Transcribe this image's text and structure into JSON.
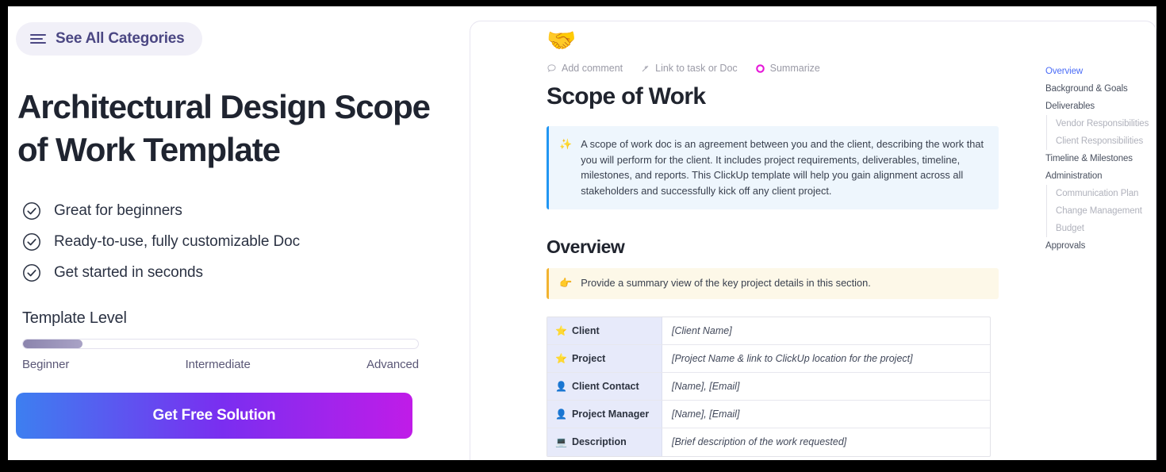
{
  "sidebar": {
    "categories_button": {
      "label": "See All Categories",
      "icon": "hamburger-icon"
    },
    "title": "Architectural Design Scope of Work Template",
    "features": [
      {
        "icon": "check-circle-icon",
        "label": "Great for beginners"
      },
      {
        "icon": "check-circle-icon",
        "label": "Ready-to-use, fully customizable Doc"
      },
      {
        "icon": "check-circle-icon",
        "label": "Get started in seconds"
      }
    ],
    "level": {
      "title": "Template Level",
      "fill_percent": "15",
      "labels": [
        "Beginner",
        "Intermediate",
        "Advanced"
      ]
    },
    "cta": {
      "label": "Get Free Solution"
    }
  },
  "preview": {
    "doc_emoji": "🤝",
    "toolbar": [
      {
        "icon": "comment-icon",
        "label": "Add comment"
      },
      {
        "icon": "link-sparkle-icon",
        "label": "Link to task or Doc"
      },
      {
        "icon": "summarize-icon",
        "label": "Summarize"
      }
    ],
    "heading": "Scope of Work",
    "intro_callout": {
      "emoji": "✨",
      "text": "A scope of work doc is an agreement between you and the client, describing the work that you will perform for the client. It includes project requirements, deliverables, timeline, milestones, and reports. This ClickUp template will help you gain alignment across all stakeholders and successfully kick off any client project."
    },
    "section_heading": "Overview",
    "section_callout": {
      "emoji": "👉",
      "text": "Provide a summary view of the key project details in this section."
    },
    "table": [
      {
        "emoji": "⭐",
        "key": "Client",
        "value": "[Client Name]"
      },
      {
        "emoji": "⭐",
        "key": "Project",
        "value": "[Project Name & link to ClickUp location for the project]"
      },
      {
        "emoji": "👤",
        "key": "Client Contact",
        "value": "[Name], [Email]"
      },
      {
        "emoji": "👤",
        "key": "Project Manager",
        "value": "[Name], [Email]"
      },
      {
        "emoji": "💻",
        "key": "Description",
        "value": "[Brief description of the work requested]"
      }
    ],
    "outline": [
      {
        "label": "Overview",
        "level": 0,
        "active": true
      },
      {
        "label": "Background & Goals",
        "level": 0,
        "active": false
      },
      {
        "label": "Deliverables",
        "level": 0,
        "active": false
      },
      {
        "label": "Vendor Responsibilities",
        "level": 1,
        "active": false
      },
      {
        "label": "Client Responsibilities",
        "level": 1,
        "active": false
      },
      {
        "label": "Timeline & Milestones",
        "level": 0,
        "active": false
      },
      {
        "label": "Administration",
        "level": 0,
        "active": false
      },
      {
        "label": "Communication Plan",
        "level": 1,
        "active": false
      },
      {
        "label": "Change Management",
        "level": 1,
        "active": false
      },
      {
        "label": "Budget",
        "level": 1,
        "active": false
      },
      {
        "label": "Approvals",
        "level": 0,
        "active": false
      }
    ]
  },
  "colors": {
    "accent_purple": "#4b4783",
    "cta_gradient_start": "#3d7ff0",
    "cta_gradient_end": "#c01ce8",
    "toc_active": "#4a6cf7",
    "callout_blue_border": "#2196f3",
    "callout_yellow_border": "#f2b330",
    "table_key_bg": "#e7eafa"
  }
}
